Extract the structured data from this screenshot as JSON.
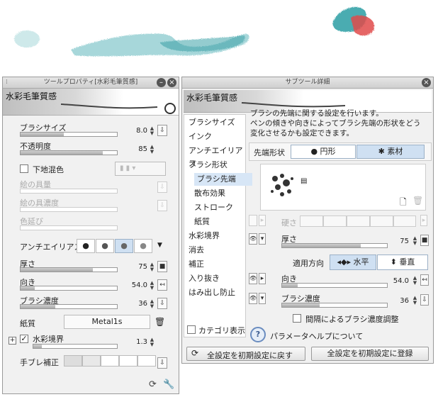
{
  "tool_property": {
    "title": "ツールプロパティ[水彩毛筆質感]",
    "preset_name": "水彩毛筆質感",
    "rows": {
      "brush_size": {
        "label": "ブラシサイズ",
        "value": "8.0",
        "level": 0.45
      },
      "opacity": {
        "label": "不透明度",
        "value": "85",
        "level": 0.85
      },
      "underlay_mix": {
        "label": "下地混色"
      },
      "paint_amount": {
        "label": "絵の具量"
      },
      "paint_density": {
        "label": "絵の具濃度"
      },
      "color_stretch": {
        "label": "色延び"
      },
      "antialias": {
        "label": "アンチエイリアス"
      },
      "thickness": {
        "label": "厚さ",
        "value": "75",
        "level": 0.75
      },
      "direction": {
        "label": "向き",
        "value": "54.0",
        "level": 0.15
      },
      "brush_density": {
        "label": "ブラシ濃度",
        "value": "36",
        "level": 0.36
      },
      "texture": {
        "label": "紙質",
        "value": "Metal1s"
      },
      "watercolor_edge": {
        "label": "水彩境界",
        "value": "1.3",
        "level": 0.1
      },
      "stabilization": {
        "label": "手ブレ補正"
      }
    }
  },
  "sub_tool_detail": {
    "title": "サブツール詳細",
    "preset_name": "水彩毛筆質感",
    "categories": [
      {
        "label": "ブラシサイズ",
        "sub": false
      },
      {
        "label": "インク",
        "sub": false
      },
      {
        "label": "アンチエイリアス",
        "sub": false
      },
      {
        "label": "ブラシ形状",
        "sub": false
      },
      {
        "label": "ブラシ先端",
        "sub": true,
        "active": true
      },
      {
        "label": "散布効果",
        "sub": true
      },
      {
        "label": "ストローク",
        "sub": true
      },
      {
        "label": "紙質",
        "sub": true
      },
      {
        "label": "水彩境界",
        "sub": false
      },
      {
        "label": "消去",
        "sub": false
      },
      {
        "label": "補正",
        "sub": false
      },
      {
        "label": "入り抜き",
        "sub": false
      },
      {
        "label": "はみ出し防止",
        "sub": false
      }
    ],
    "category_display": "カテゴリ表示",
    "description": [
      "ブラシの先端に関する設定を行います。",
      "ペンの傾きや向きによってブラシ先端の形状をどう",
      "変化させるかも設定できます。"
    ],
    "tip_shape": {
      "label": "先端形状",
      "circle": "円形",
      "material": "素材"
    },
    "hardness": {
      "label": "硬さ"
    },
    "thickness": {
      "label": "厚さ",
      "value": "75",
      "level": 0.75
    },
    "apply_direction": {
      "label": "適用方向",
      "horizontal": "水平",
      "vertical": "垂直"
    },
    "direction": {
      "label": "向き",
      "value": "54.0",
      "level": 0.15
    },
    "brush_density": {
      "label": "ブラシ濃度",
      "value": "36",
      "level": 0.36
    },
    "interval_density": {
      "label": "間隔によるブラシ濃度調整"
    },
    "param_help": "パラメータヘルプについて",
    "reset_button": "全設定を初期設定に戻す",
    "register_button": "全設定を初期設定に登録"
  },
  "colors": {
    "accent": "#cfe0f2",
    "stroke": "#3aa7ad",
    "red": "#e04a4a"
  }
}
